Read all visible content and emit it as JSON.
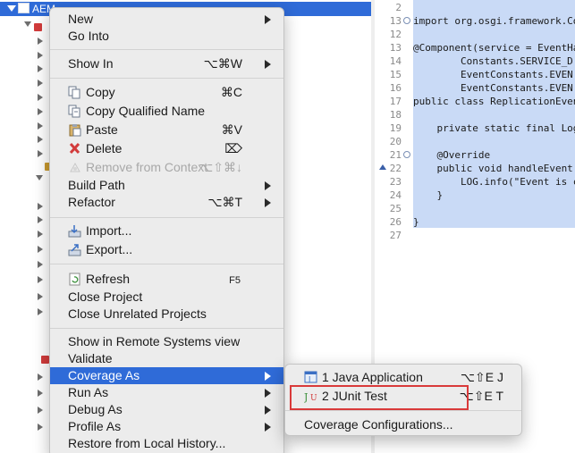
{
  "explorer": {
    "selected_project": "AEM"
  },
  "editor": {
    "lines": [
      {
        "no": "2",
        "code": ""
      },
      {
        "no": "13",
        "code": "import org.osgi.framework.Co"
      },
      {
        "no": "12",
        "code": ""
      },
      {
        "no": "13",
        "code": "@Component(service = EventHa"
      },
      {
        "no": "14",
        "code": "        Constants.SERVICE_D"
      },
      {
        "no": "15",
        "code": "        EventConstants.EVEN"
      },
      {
        "no": "16",
        "code": "        EventConstants.EVEN"
      },
      {
        "no": "17",
        "code": "public class ReplicationEven"
      },
      {
        "no": "18",
        "code": ""
      },
      {
        "no": "19",
        "code": "    private static final Log"
      },
      {
        "no": "20",
        "code": ""
      },
      {
        "no": "21",
        "code": "    @Override"
      },
      {
        "no": "22",
        "code": "    public void handleEvent("
      },
      {
        "no": "23",
        "code": "        LOG.info(\"Event is c"
      },
      {
        "no": "24",
        "code": "    }"
      },
      {
        "no": "25",
        "code": ""
      },
      {
        "no": "26",
        "code": "}"
      },
      {
        "no": "27",
        "code": ""
      }
    ]
  },
  "context_menu": {
    "new": "New",
    "go_into": "Go Into",
    "show_in": "Show In",
    "show_in_shortcut": "⌥⌘W",
    "copy": "Copy",
    "copy_shortcut": "⌘C",
    "copy_qualified_name": "Copy Qualified Name",
    "paste": "Paste",
    "paste_shortcut": "⌘V",
    "delete": "Delete",
    "delete_shortcut": "⌦",
    "remove_from_context": "Remove from Context",
    "remove_from_context_shortcut": "⌥⇧⌘↓",
    "build_path": "Build Path",
    "refactor": "Refactor",
    "refactor_shortcut": "⌥⌘T",
    "import": "Import...",
    "export": "Export...",
    "refresh": "Refresh",
    "refresh_shortcut": "F5",
    "close_project": "Close Project",
    "close_unrelated_projects": "Close Unrelated Projects",
    "show_in_remote_systems_view": "Show in Remote Systems view",
    "validate": "Validate",
    "coverage_as": "Coverage As",
    "run_as": "Run As",
    "debug_as": "Debug As",
    "profile_as": "Profile As",
    "restore_from_local_history": "Restore from Local History..."
  },
  "coverage_submenu": {
    "java_application": "1 Java Application",
    "java_application_shortcut": "⌥⇧E J",
    "junit_test": "2 JUnit Test",
    "junit_test_shortcut": "⌥⇧E T",
    "coverage_configurations": "Coverage Configurations..."
  },
  "colors": {
    "selection": "#2f6bd8",
    "annotation_box": "#d93a3a",
    "menu_background": "#ececec"
  }
}
